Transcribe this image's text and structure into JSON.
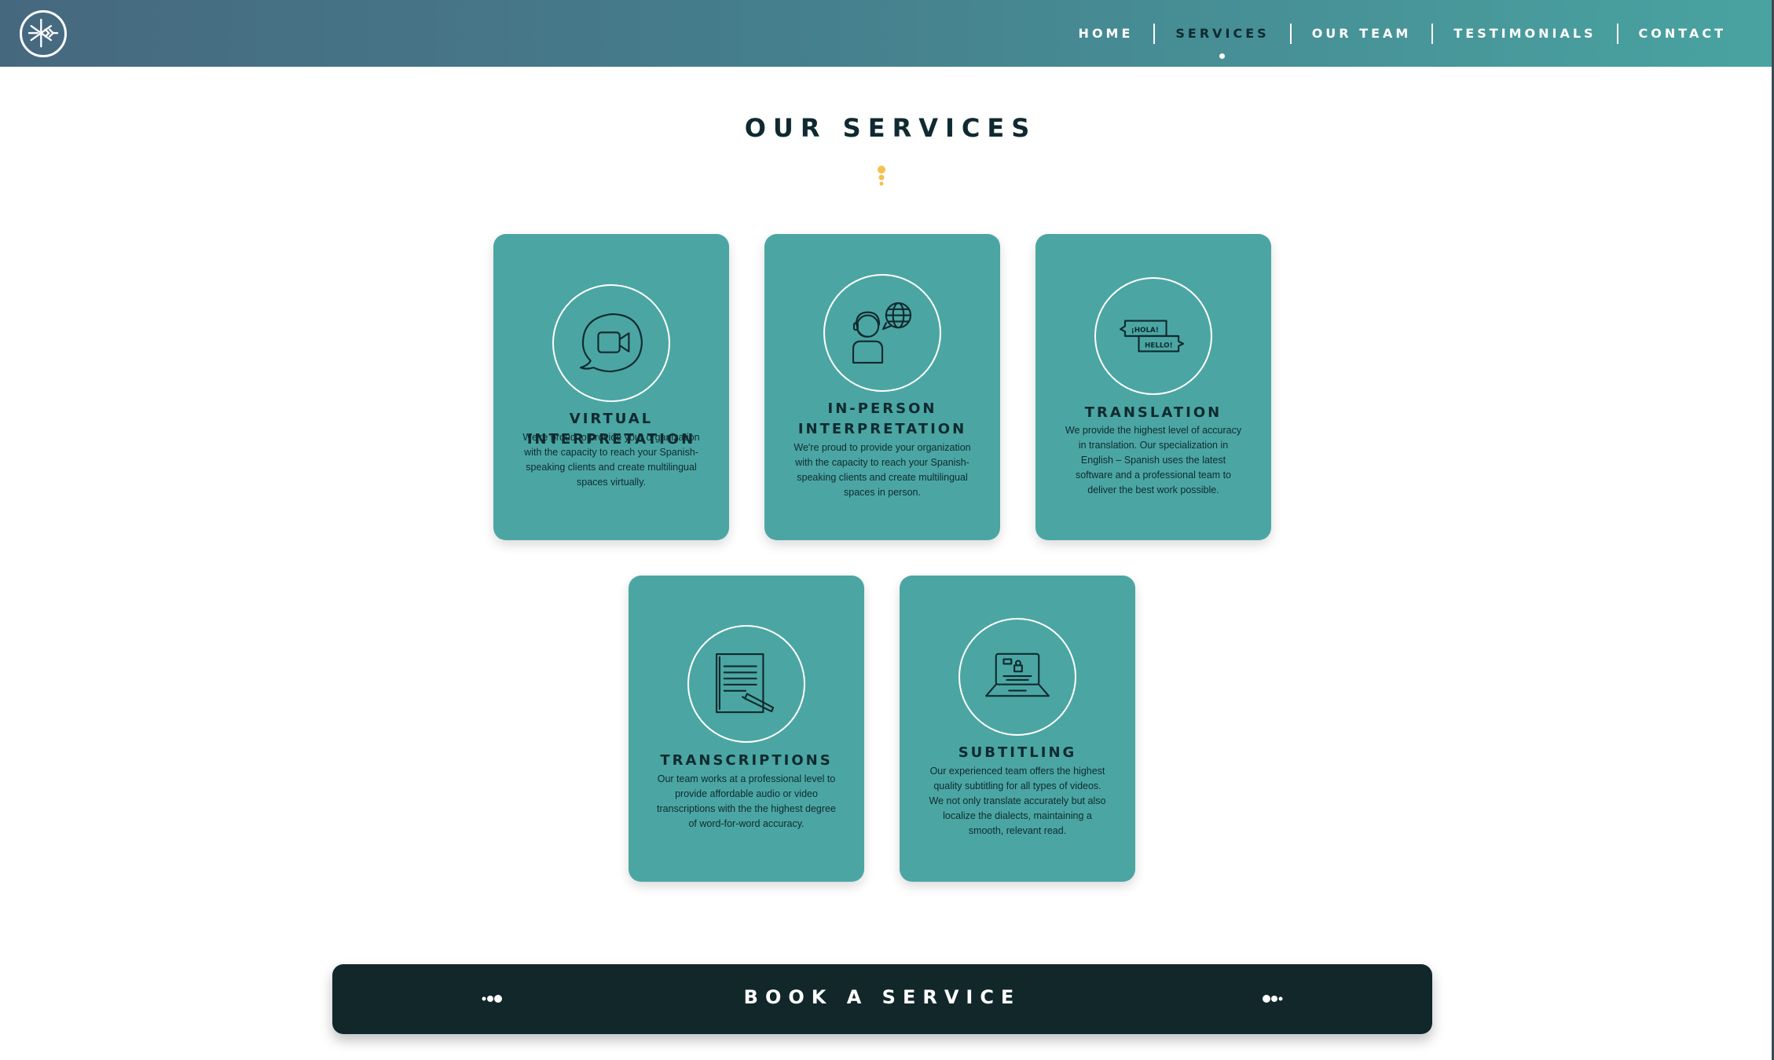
{
  "header": {
    "logo_icon": "asterisk-arrows-logo",
    "nav": [
      {
        "label": "HOME",
        "active": false
      },
      {
        "label": "SERVICES",
        "active": true
      },
      {
        "label": "OUR TEAM",
        "active": false
      },
      {
        "label": "TESTIMONIALS",
        "active": false
      },
      {
        "label": "CONTACT",
        "active": false
      }
    ]
  },
  "section": {
    "title": "OUR SERVICES",
    "decoration_icon": "vertical-dots-divider"
  },
  "services": [
    {
      "title": "VIRTUAL INTERPRETATION",
      "text": "We're proud to provide your organization with the capacity to reach your Spanish-speaking clients and create multilingual spaces virtually.",
      "icon": "video-chat-bubble-icon"
    },
    {
      "title": "IN-PERSON INTERPRETATION",
      "text": "We're proud to provide your organization with the capacity to reach your Spanish-speaking clients and create multilingual spaces in person.",
      "icon": "interpreter-headset-globe-icon"
    },
    {
      "title": "TRANSLATION",
      "text": "We provide the highest level of accuracy in translation. Our specialization in English – Spanish uses the latest software and a professional team to deliver the best work possible.",
      "icon": "speech-bubbles-hola-hello-icon",
      "icon_text": [
        "¡HOLA!",
        "HELLO!"
      ]
    },
    {
      "title": "TRANSCRIPTIONS",
      "text": "Our team works at a professional level to provide affordable audio or video transcriptions with the the highest degree of word-for-word accuracy.",
      "icon": "document-pen-icon"
    },
    {
      "title": "SUBTITLING",
      "text": "Our experienced team offers the highest quality subtitling for all types of videos. We not only translate accurately but also localize the dialects, maintaining a smooth, relevant read.",
      "icon": "laptop-subtitles-icon"
    }
  ],
  "book": {
    "label": "BOOK A SERVICE",
    "left_icon": "dots-decoration-left-icon",
    "right_icon": "dots-decoration-right-icon"
  },
  "colors": {
    "header_gradient_start": "#46687f",
    "header_gradient_end": "#49a3a0",
    "card_teal": "#4ba6a3",
    "text_dark": "#0f2a30",
    "accent_yellow": "#f2c14e",
    "button_dark": "#11272a"
  }
}
